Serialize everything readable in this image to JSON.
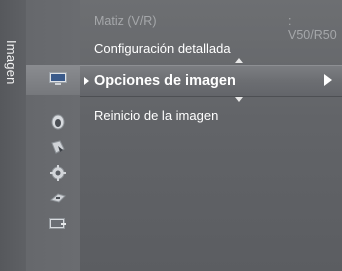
{
  "side_tab": {
    "label": "Imagen"
  },
  "icons": [
    "picture-icon",
    "sound-icon",
    "channel-icon",
    "setup-icon",
    "input-icon",
    "application-icon"
  ],
  "menu": {
    "dim_item": {
      "label": "Matiz (V/R)",
      "value": ": V50/R50"
    },
    "items": [
      {
        "label": "Configuración detallada"
      },
      {
        "label": "Opciones de imagen",
        "selected": true
      },
      {
        "label": "Reinicio de la imagen"
      }
    ]
  },
  "colors": {
    "background": "#626468",
    "selected": "#76787c",
    "text": "#ffffff",
    "dim_text": "#a5a7aa"
  }
}
